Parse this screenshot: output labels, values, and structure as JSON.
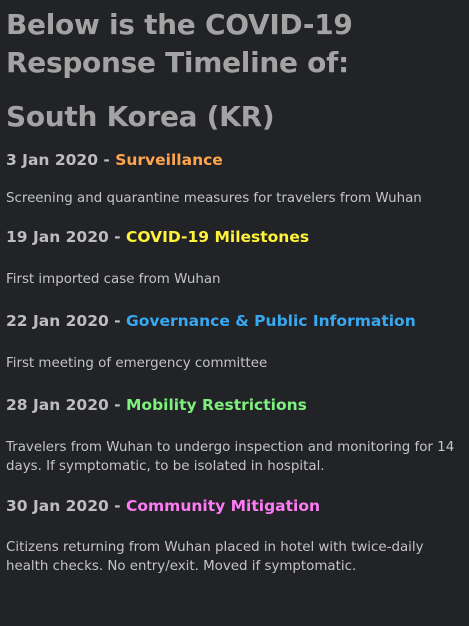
{
  "header": {
    "title_line1": "Below is the COVID-19",
    "title_line2": "Response Timeline of:",
    "country": "South Korea (KR)"
  },
  "events": [
    {
      "date": "3 Jan 2020",
      "separator": " - ",
      "category": "Surveillance",
      "category_color": "#ffa64d",
      "description": "Screening and quarantine measures for travelers from Wuhan"
    },
    {
      "date": "19 Jan 2020",
      "separator": " - ",
      "category": "COVID-19 Milestones",
      "category_color": "#fff23a",
      "description": "First imported case from Wuhan"
    },
    {
      "date": "22 Jan 2020",
      "separator": " - ",
      "category": "Governance & Public Information",
      "category_color": "#36a9f2",
      "description": "First meeting of emergency committee"
    },
    {
      "date": "28 Jan 2020",
      "separator": " - ",
      "category": "Mobility Restrictions",
      "category_color": "#7ef07e",
      "description": "Travelers from Wuhan to undergo inspection and monitoring for 14 days. If symptomatic, to be isolated in hospital."
    },
    {
      "date": "30 Jan 2020",
      "separator": " - ",
      "category": "Community Mitigation",
      "category_color": "#ff7af5",
      "description": "Citizens returning from Wuhan placed in hotel with twice-daily health checks. No entry/exit. Moved if symptomatic."
    }
  ]
}
